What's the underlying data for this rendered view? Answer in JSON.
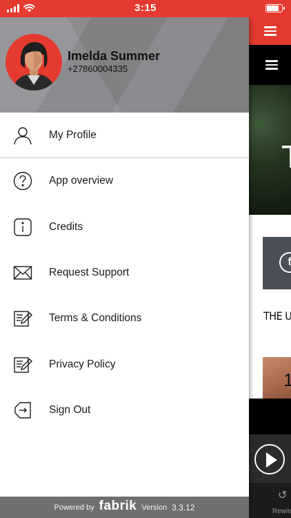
{
  "status_bar": {
    "time": "3:15",
    "signal_icon": "cellular-signal-icon",
    "wifi_icon": "wifi-icon",
    "battery_icon": "battery-icon",
    "accent_color": "#e53a2f"
  },
  "drawer": {
    "user": {
      "name": "Imelda Summer",
      "phone": "+27860004335",
      "avatar_icon": "user-avatar"
    },
    "menu": [
      {
        "label": "My Profile",
        "icon": "person-icon"
      },
      {
        "label": "App overview",
        "icon": "question-circle-icon"
      },
      {
        "label": "Credits",
        "icon": "info-icon"
      },
      {
        "label": "Request Support",
        "icon": "envelope-icon"
      },
      {
        "label": "Terms & Conditions",
        "icon": "document-edit-icon"
      },
      {
        "label": "Privacy Policy",
        "icon": "document-edit-icon"
      },
      {
        "label": "Sign Out",
        "icon": "sign-out-icon"
      }
    ],
    "footer": {
      "powered_by": "Powered by",
      "brand": "fabrik",
      "version_label": "Version",
      "version": "3.3.12"
    }
  },
  "background_app": {
    "hero_letter": "T",
    "card_icon_letter": "f",
    "section_heading": "THE UR",
    "thumb_number": "1",
    "bottom_nav_label": "Rewin"
  }
}
